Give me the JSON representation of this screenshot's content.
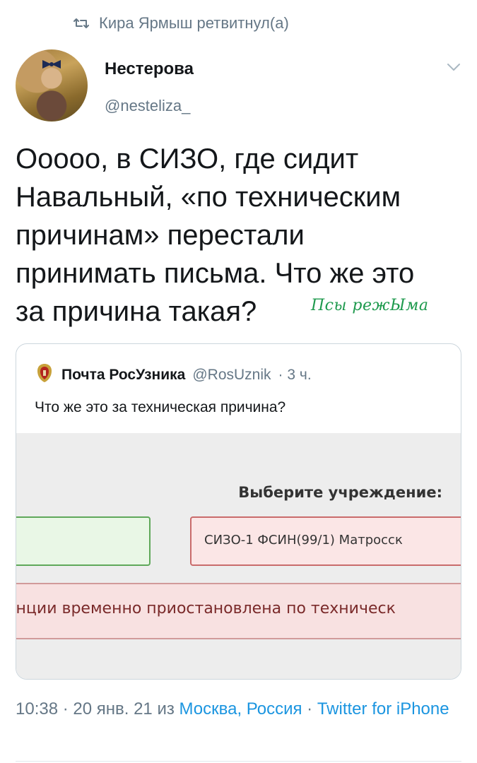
{
  "retweet": {
    "label": "Кира Ярмыш ретвитнул(а)",
    "icon": "retweet-icon"
  },
  "tweet": {
    "author_name": "Нестерова",
    "author_handle": "@nesteliza_",
    "text_lines": [
      "Ооооо, в СИЗО, где сидит",
      "Навальный, «по техническим",
      "причинам» перестали",
      "принимать письма. Что же это",
      "за причина такая?"
    ],
    "signature": "Псы режЫма",
    "menu_icon": "chevron-down-icon"
  },
  "quote": {
    "icon": "coat-of-arms-icon",
    "name": "Почта РосУзника",
    "handle": "@RosUznik",
    "time": "· 3 ч.",
    "text": "Что же это за техническая причина?",
    "media": {
      "label": "Выберите учреждение:",
      "select_value": "СИЗО-1 ФСИН(99/1) Матросск",
      "error_text": "енции временно приостановлена по техническ"
    }
  },
  "meta": {
    "time_date": "10:38 · 20 янв. 21 из ",
    "location": "Москва, Россия",
    "separator": " · ",
    "source": "Twitter for iPhone"
  },
  "colors": {
    "text": "#14171a",
    "secondary": "#657786",
    "link": "#1b95e0",
    "signature": "#1f9a4e",
    "border": "#ccd6dd"
  }
}
